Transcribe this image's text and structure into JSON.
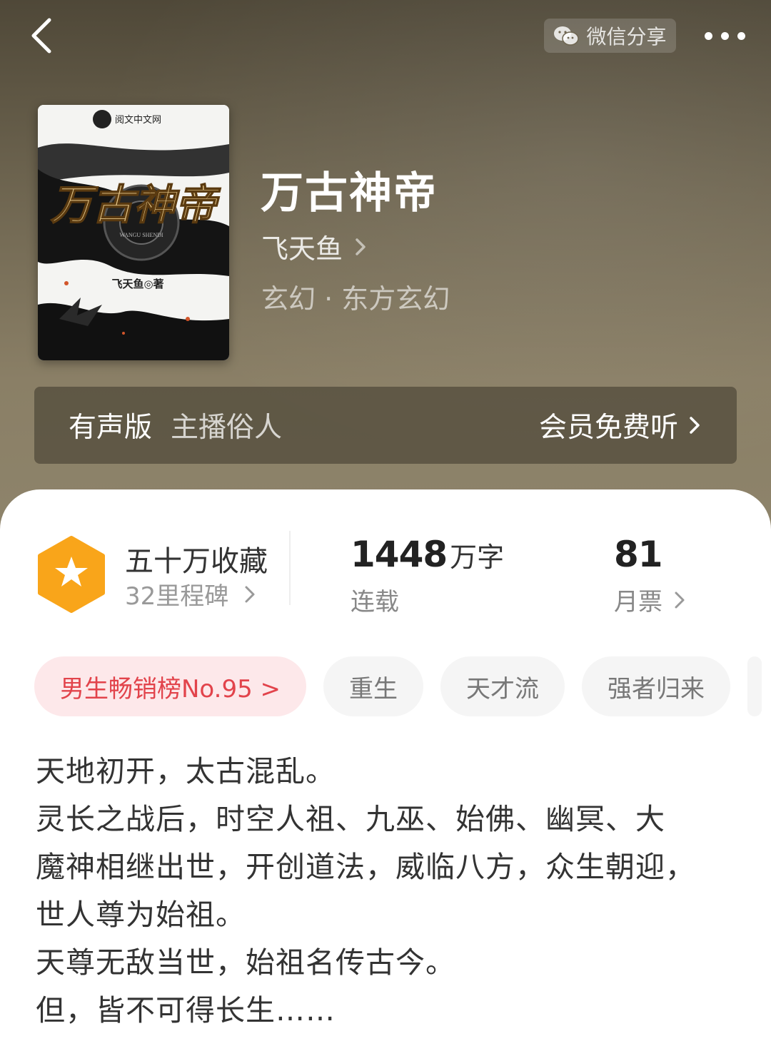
{
  "header": {
    "share_label": "微信分享"
  },
  "book": {
    "title": "万古神帝",
    "author": "飞天鱼",
    "genre": "玄幻 · 东方玄幻",
    "cover": {
      "publisher": "阅文中文网",
      "title_art": "万古神帝",
      "pinyin": "WANGU SHENDI",
      "author_line": "飞天鱼◎著"
    }
  },
  "audio": {
    "label": "有声版",
    "host": "主播俗人",
    "cta": "会员免费听"
  },
  "stats": {
    "favorites": {
      "title": "五十万收藏",
      "sub": "32里程碑"
    },
    "words": {
      "value": "1448",
      "unit": "万字",
      "status": "连载"
    },
    "votes": {
      "value": "81",
      "label": "月票"
    }
  },
  "tags": [
    "男生畅销榜No.95 >",
    "重生",
    "天才流",
    "强者归来"
  ],
  "description": [
    "天地初开，太古混乱。",
    "灵长之战后，时空人祖、九巫、始佛、幽冥、大",
    "魔神相继出世，开创道法，威临八方，众生朝迎，",
    "世人尊为始祖。",
    "天尊无敌当世，始祖名传古今。",
    "但，皆不可得长生……"
  ],
  "colors": {
    "rank_tag_bg": "#fde8ea",
    "rank_tag_text": "#e2434b",
    "badge": "#f9a51a"
  }
}
